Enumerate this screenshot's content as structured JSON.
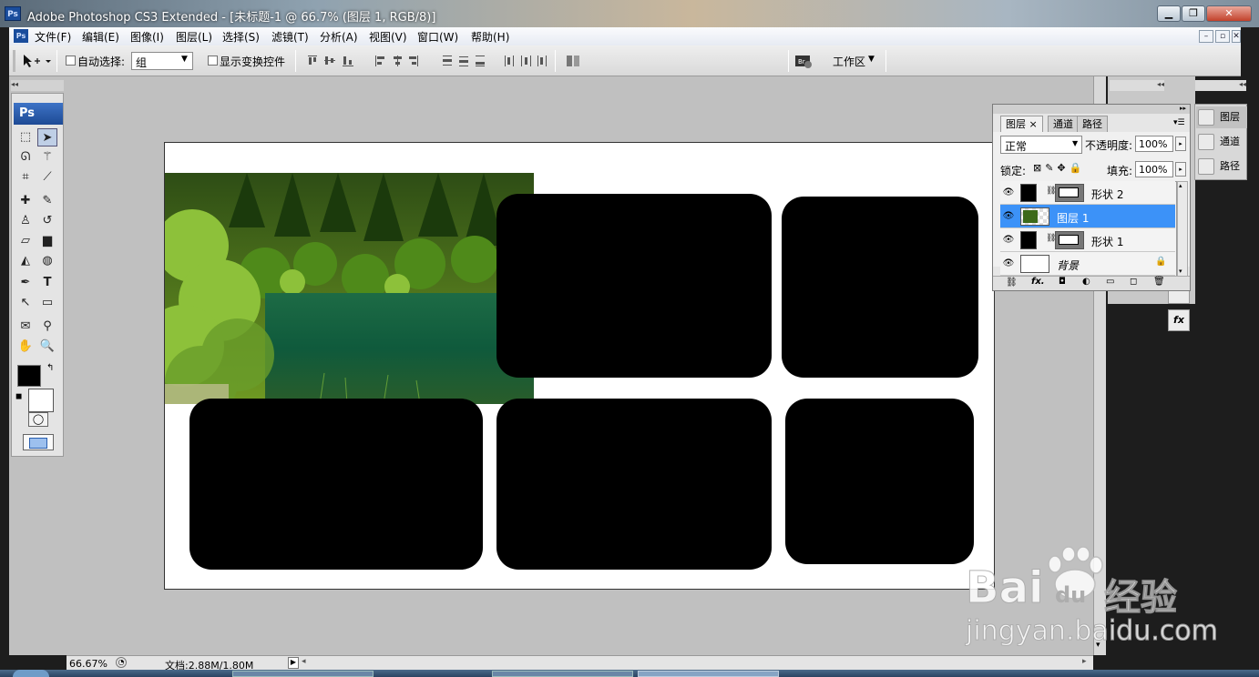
{
  "window": {
    "title": "Adobe Photoshop CS3 Extended - [未标题-1 @ 66.7% (图层 1, RGB/8)]",
    "app_icon": "Ps",
    "min": "▁",
    "restore": "❐",
    "close": "✕"
  },
  "menu": {
    "doc_icon": "Ps",
    "items": [
      "文件(F)",
      "编辑(E)",
      "图像(I)",
      "图层(L)",
      "选择(S)",
      "滤镜(T)",
      "分析(A)",
      "视图(V)",
      "窗口(W)",
      "帮助(H)"
    ],
    "doc_min": "–",
    "doc_restore": "▫",
    "doc_close": "✕"
  },
  "options": {
    "auto_select_label": "自动选择:",
    "auto_select_value": "组",
    "show_transform_label": "显示变换控件",
    "workspace_label": "工作区"
  },
  "toolbox": {
    "logo": "Ps",
    "fg_color": "#000000",
    "bg_color": "#ffffff"
  },
  "status": {
    "zoom": "66.67%",
    "doc_size": "文档:2.88M/1.80M"
  },
  "layers_panel": {
    "tabs": [
      "图层 ×",
      "通道",
      "路径"
    ],
    "blend_mode": "正常",
    "opacity_label": "不透明度:",
    "opacity": "100%",
    "lock_label": "锁定:",
    "fill_label": "填充:",
    "fill": "100%",
    "layers": [
      {
        "name": "形状 2",
        "selected": false
      },
      {
        "name": "图层 1",
        "selected": true
      },
      {
        "name": "形状 1",
        "selected": false
      },
      {
        "name": "背景",
        "selected": false
      }
    ],
    "footer_fx": "fx."
  },
  "right_dock": {
    "items": [
      "图层",
      "通道",
      "路径"
    ],
    "fx": "fx"
  },
  "watermark": {
    "brand": "Bai",
    "brand2": "du",
    "cn": "经验",
    "url": "jingyan.baidu.com"
  },
  "colors": {
    "selection": "#3c92f8",
    "workspace_gray": "#c0c0c0"
  }
}
